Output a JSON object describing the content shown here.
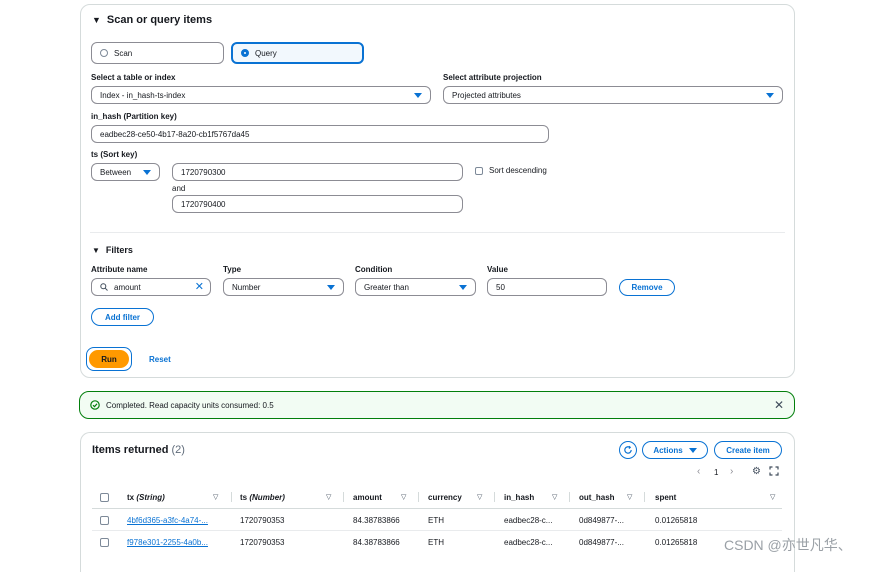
{
  "query_panel": {
    "title": "Scan or query items",
    "mode_scan": "Scan",
    "mode_query": "Query",
    "table_label": "Select a table or index",
    "table_value": "Index - in_hash-ts-index",
    "projection_label": "Select attribute projection",
    "projection_value": "Projected attributes",
    "partition_label": "in_hash (Partition key)",
    "partition_value": "eadbec28-ce50-4b17-8a20-cb1f5767da45",
    "sort_label": "ts (Sort key)",
    "sort_operator": "Between",
    "sort_from": "1720790300",
    "sort_and": "and",
    "sort_to": "1720790400",
    "sort_desc_label": "Sort descending",
    "filters_title": "Filters",
    "filter_attr_label": "Attribute name",
    "filter_type_label": "Type",
    "filter_cond_label": "Condition",
    "filter_value_label": "Value",
    "filter_attr_value": "amount",
    "filter_type_value": "Number",
    "filter_cond_value": "Greater than",
    "filter_value_value": "50",
    "remove_label": "Remove",
    "add_filter_label": "Add filter",
    "run_label": "Run",
    "reset_label": "Reset"
  },
  "status": {
    "message": "Completed. Read capacity units consumed: 0.5",
    "color": "#037f0c"
  },
  "results": {
    "title": "Items returned",
    "count": "(2)",
    "actions_label": "Actions",
    "create_label": "Create item",
    "page": "1",
    "columns": [
      {
        "name": "tx",
        "type": "(String)"
      },
      {
        "name": "ts",
        "type": "(Number)"
      },
      {
        "name": "amount",
        "type": ""
      },
      {
        "name": "currency",
        "type": ""
      },
      {
        "name": "in_hash",
        "type": ""
      },
      {
        "name": "out_hash",
        "type": ""
      },
      {
        "name": "spent",
        "type": ""
      }
    ],
    "rows": [
      [
        "4bf6d365-a3fc-4a74-...",
        "1720790353",
        "84.38783866",
        "ETH",
        "eadbec28-c...",
        "0d849877-...",
        "0.01265818"
      ],
      [
        "f978e301-2255-4a0b...",
        "1720790353",
        "84.38783866",
        "ETH",
        "eadbec28-c...",
        "0d849877-...",
        "0.01265818"
      ]
    ]
  },
  "watermark": "CSDN @亦世凡华、",
  "colors": {
    "accent": "#0972d3",
    "run": "#ff9900",
    "success": "#037f0c"
  }
}
